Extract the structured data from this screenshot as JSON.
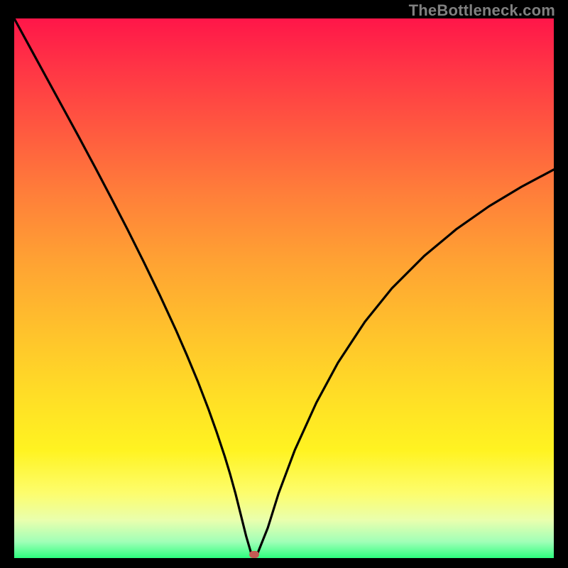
{
  "watermark": "TheBottleneck.com",
  "colors": {
    "page_bg": "#000000",
    "gradient_top": "#ff1649",
    "gradient_bottom": "#2dff7e",
    "curve": "#000000",
    "marker": "#c35b54",
    "watermark": "#808080"
  },
  "chart_data": {
    "type": "line",
    "title": "",
    "xlabel": "",
    "ylabel": "",
    "xlim": [
      0,
      100
    ],
    "ylim": [
      0,
      100
    ],
    "grid": false,
    "legend": false,
    "series": [
      {
        "name": "bottleneck-curve",
        "x": [
          0,
          3,
          6,
          9,
          12,
          15,
          18,
          21,
          24,
          27,
          30,
          32,
          34,
          36,
          37.5,
          39,
          40,
          41,
          42,
          43,
          44,
          45,
          47,
          49,
          52,
          56,
          60,
          65,
          70,
          76,
          82,
          88,
          94,
          100
        ],
        "values": [
          100,
          94.5,
          89,
          83.5,
          78,
          72.4,
          66.7,
          60.9,
          54.9,
          48.7,
          42.2,
          37.6,
          32.8,
          27.6,
          23.4,
          18.9,
          15.6,
          12.0,
          8.0,
          4.0,
          0.6,
          0.6,
          5.6,
          12.0,
          20.0,
          28.8,
          36.2,
          43.8,
          50.0,
          56.0,
          61.0,
          65.2,
          68.8,
          72.0
        ]
      }
    ],
    "annotations": [
      {
        "name": "minimum-marker",
        "x": 44.5,
        "y": 0.6
      }
    ]
  }
}
